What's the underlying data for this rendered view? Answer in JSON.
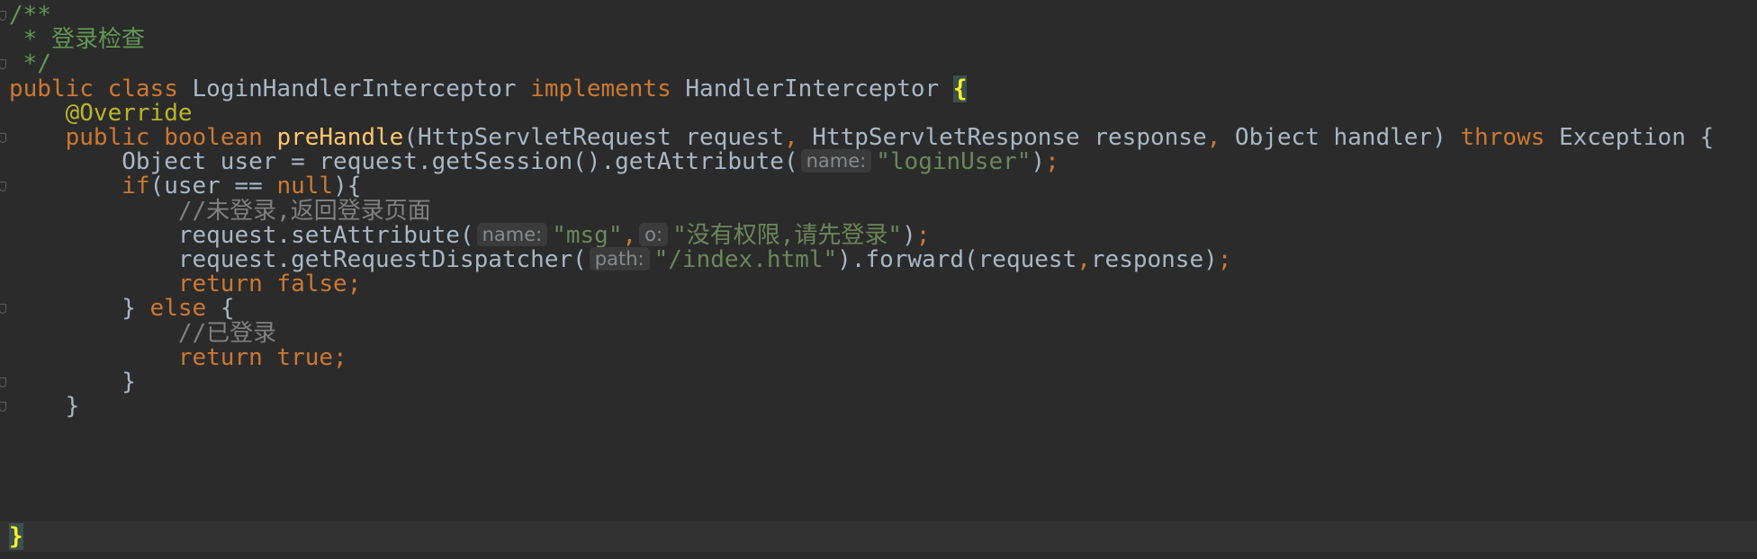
{
  "editor": {
    "doc_open": "/**",
    "doc_body": " * 登录检查",
    "doc_close": " */",
    "class_kw_public": "public",
    "class_kw_class": "class",
    "class_name": "LoginHandlerInterceptor",
    "class_kw_implements": "implements",
    "interface_name": "HandlerInterceptor",
    "open_brace": "{",
    "annotation": "@Override",
    "method_kw_public": "public",
    "method_kw_boolean": "boolean",
    "method_name": "preHandle",
    "param_type_1": "HttpServletRequest",
    "param_name_1": "request",
    "param_type_2": "HttpServletResponse",
    "param_name_2": "response",
    "param_type_3": "Object",
    "param_name_3": "handler",
    "throws_kw": "throws",
    "exception_type": "Exception",
    "line_get_attr_prefix": "Object user = request.getSession().getAttribute(",
    "hint_name_1": "name:",
    "str_login_user": "\"loginUser\"",
    "if_kw": "if",
    "if_cond": "(user == ",
    "null_kw": "null",
    "if_close": "){",
    "comment_not_logged": "//未登录,返回登录页面",
    "set_attr_prefix": "request.setAttribute(",
    "hint_name_2": "name:",
    "str_msg": "\"msg\"",
    "hint_o": "o:",
    "str_no_permission": "\"没有权限,请先登录\"",
    "dispatcher_prefix": "request.getRequestDispatcher(",
    "hint_path": "path:",
    "str_index": "\"/index.html\"",
    "forward_call": ").forward(request",
    "forward_arg2": "response)",
    "return_kw": "return",
    "false_kw": "false",
    "else_close_brace": "} ",
    "else_kw": "else",
    "else_open_brace": " {",
    "comment_logged": "//已登录",
    "true_kw": "true",
    "close_brace_inner": "}",
    "close_brace_method": "}",
    "close_brace_class": "}"
  }
}
